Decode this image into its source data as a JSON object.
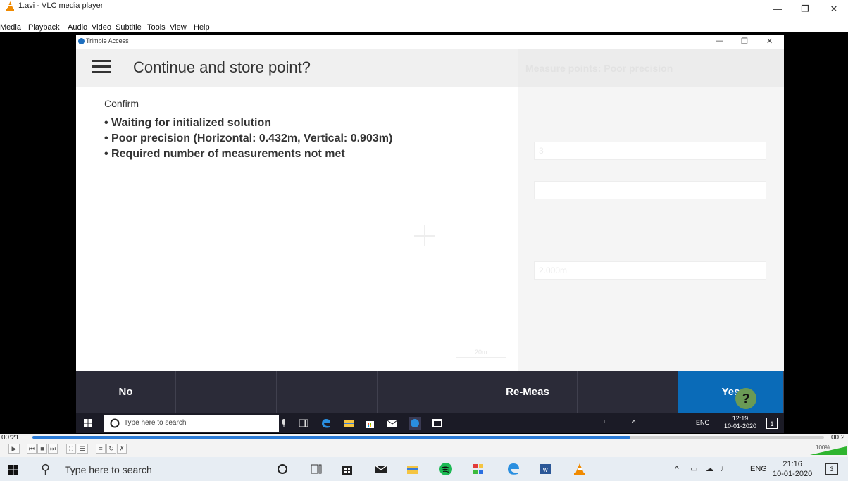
{
  "vlc": {
    "title": "1.avi - VLC media player",
    "menu": [
      "Media",
      "Playback",
      "Audio",
      "Video",
      "Subtitle",
      "Tools",
      "View",
      "Help"
    ],
    "window_controls": {
      "minimize": "—",
      "maximize": "❐",
      "close": "✕"
    },
    "time_elapsed": "00:21",
    "time_total": "00:2",
    "seek_fraction": 0.755,
    "volume_label": "100%"
  },
  "trimble": {
    "window_title": "Trimble Access",
    "window_controls": {
      "minimize": "—",
      "maximize": "❐",
      "close": "✕"
    },
    "dialog_title": "Continue and store point?",
    "confirm_label": "Confirm",
    "messages": [
      "• Waiting for initialized solution",
      "• Poor precision (Horizontal: 0.432m, Vertical: 0.903m)",
      "• Required number of measurements not met"
    ],
    "background_panel_title": "Measure points: Poor precision",
    "background_fields": [
      "3",
      "",
      "2.000m"
    ],
    "buttons": {
      "no": "No",
      "remeas": "Re-Meas",
      "yes": "Yes"
    },
    "help_glyph": "?",
    "scale_label": "20m"
  },
  "inner_taskbar": {
    "search_placeholder": "Type here to search",
    "lang": "ENG",
    "time": "12:19",
    "date": "10-01-2020",
    "notifications": "1"
  },
  "host_taskbar": {
    "search_placeholder": "Type here to search",
    "lang": "ENG",
    "time": "21:16",
    "date": "10-01-2020",
    "notifications": "3",
    "icons": [
      "cortana-icon",
      "task-view-icon",
      "store-icon",
      "mail-icon",
      "file-explorer-icon",
      "spotify-icon",
      "app-icon",
      "edge-icon",
      "word-icon",
      "vlc-icon"
    ]
  },
  "colors": {
    "accent": "#0a6bb8",
    "footer_bg": "#2b2b38",
    "vlc_orange": "#f08a00"
  }
}
